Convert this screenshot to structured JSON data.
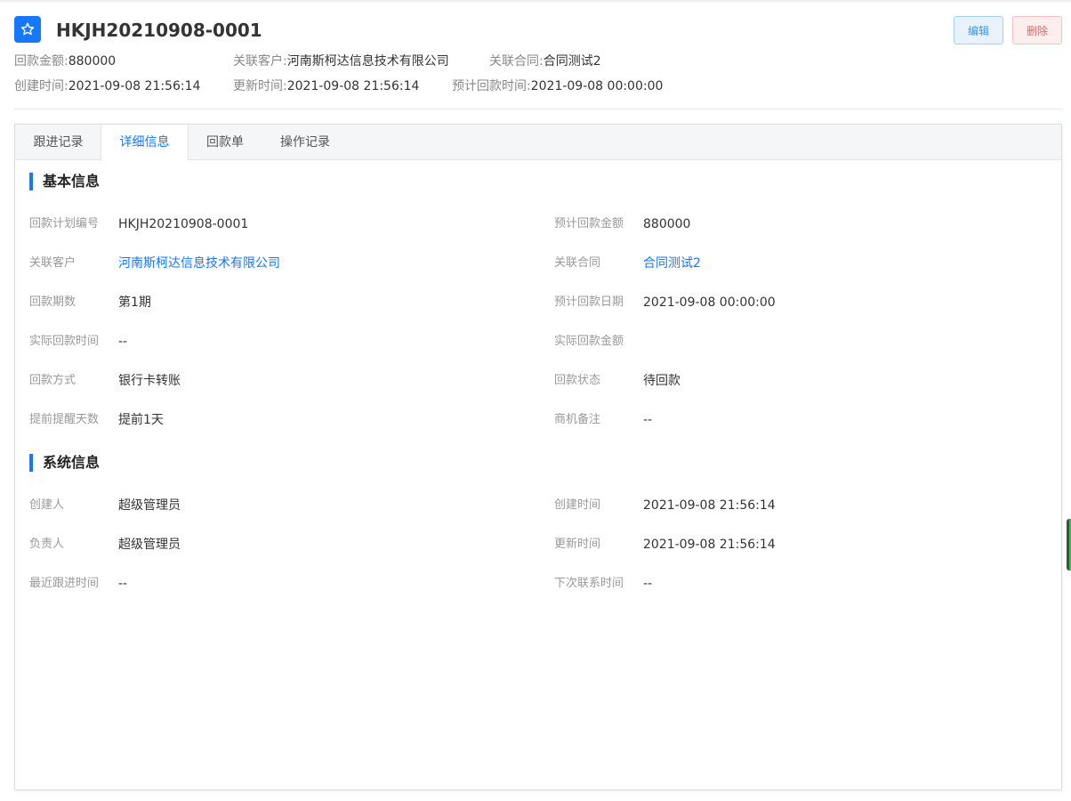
{
  "header": {
    "title": "HKJH20210908-0001",
    "edit_label": "编辑",
    "delete_label": "删除"
  },
  "meta": {
    "amount_label": "回款金额:",
    "amount_value": "880000",
    "customer_label": "关联客户:",
    "customer_value": "河南斯柯达信息技术有限公司",
    "contract_label": "关联合同:",
    "contract_value": "合同测试2",
    "created_label": "创建时间:",
    "created_value": "2021-09-08 21:56:14",
    "updated_label": "更新时间:",
    "updated_value": "2021-09-08 21:56:14",
    "planned_label": "预计回款时间:",
    "planned_value": "2021-09-08 00:00:00"
  },
  "tabs": [
    {
      "label": "跟进记录"
    },
    {
      "label": "详细信息"
    },
    {
      "label": "回款单"
    },
    {
      "label": "操作记录"
    }
  ],
  "active_tab": "详细信息",
  "basic": {
    "title": "基本信息",
    "fields": [
      {
        "label": "回款计划编号",
        "value": "HKJH20210908-0001"
      },
      {
        "label": "预计回款金额",
        "value": "880000"
      },
      {
        "label": "关联客户",
        "value": "河南斯柯达信息技术有限公司"
      },
      {
        "label": "关联合同",
        "value": "合同测试2"
      },
      {
        "label": "回款期数",
        "value": "第1期"
      },
      {
        "label": "预计回款日期",
        "value": "2021-09-08 00:00:00"
      },
      {
        "label": "实际回款时间",
        "value": "--"
      },
      {
        "label": "实际回款金额",
        "value": ""
      },
      {
        "label": "回款方式",
        "value": "银行卡转账"
      },
      {
        "label": "回款状态",
        "value": "待回款"
      },
      {
        "label": "提前提醒天数",
        "value": "提前1天"
      },
      {
        "label": "商机备注",
        "value": "--"
      }
    ]
  },
  "system": {
    "title": "系统信息",
    "fields": [
      {
        "label": "创建人",
        "value": "超级管理员"
      },
      {
        "label": "创建时间",
        "value": "2021-09-08 21:56:14"
      },
      {
        "label": "负责人",
        "value": "超级管理员"
      },
      {
        "label": "更新时间",
        "value": "2021-09-08 21:56:14"
      },
      {
        "label": "最近跟进时间",
        "value": "--"
      },
      {
        "label": "下次联系时间",
        "value": "--"
      }
    ]
  },
  "colors": {
    "accent": "#1677ff",
    "delete": "#e86363"
  },
  "icons": {
    "title_icon": "star-icon"
  }
}
